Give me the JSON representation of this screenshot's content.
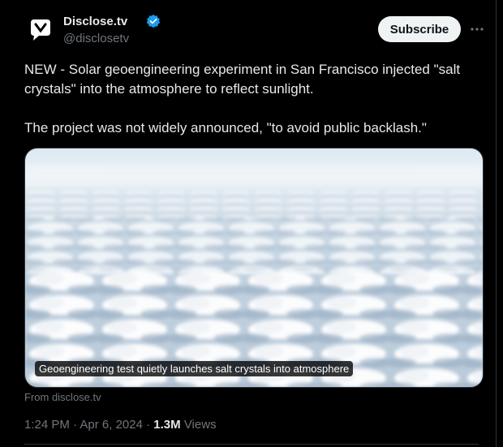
{
  "author": {
    "display_name": "Disclose.tv",
    "handle": "@disclosetv",
    "verified": true
  },
  "subscribe_label": "Subscribe",
  "more_icon": "more-horizontal-icon",
  "tweet": {
    "text": "NEW - Solar geoengineering experiment in San Francisco injected \"salt crystals\" into the atmosphere to reflect sunlight.\n\nThe project was not widely announced, \"to avoid public backlash.\""
  },
  "card": {
    "caption": "Geoengineering test quietly launches salt crystals into atmosphere",
    "source": "From disclose.tv"
  },
  "meta": {
    "time": "1:24 PM",
    "date": "Apr 6, 2024",
    "separator": " · ",
    "views_count": "1.3M",
    "views_label": "Views"
  },
  "colors": {
    "background": "#000000",
    "text_primary": "#e7e9ea",
    "text_secondary": "#71767b",
    "verified_blue": "#1d9bf0",
    "border": "#2f3336"
  }
}
